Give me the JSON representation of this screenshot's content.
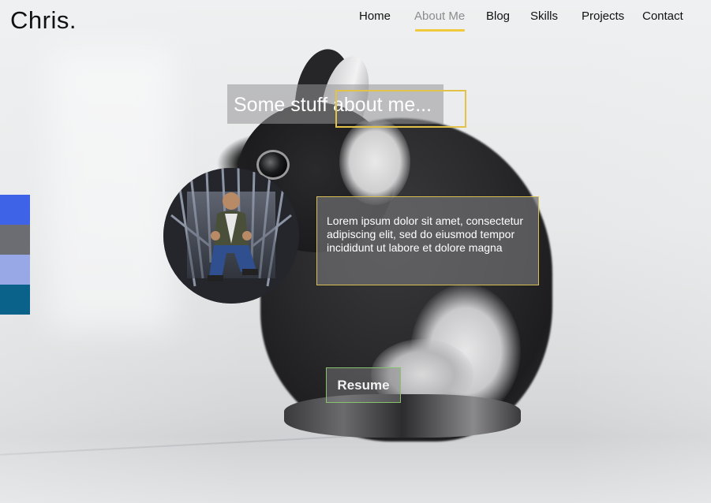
{
  "logo": "Chris.",
  "nav": {
    "items": [
      {
        "label": "Home",
        "active": false
      },
      {
        "label": "About Me",
        "active": true
      },
      {
        "label": "Blog",
        "active": false
      },
      {
        "label": "Skills",
        "active": false
      },
      {
        "label": "Projects",
        "active": false
      },
      {
        "label": "Contact",
        "active": false
      }
    ],
    "active_underline_color": "#f0c93d"
  },
  "swatches": [
    "#3f63e6",
    "#6b6d72",
    "#98a8e6",
    "#0a6189"
  ],
  "about": {
    "heading": "Some stuff about me...",
    "bio": "Lorem ipsum dolor sit amet, consectetur adipiscing elit, sed do eiusmod tempor incididunt ut labore et dolore magna",
    "resume_label": "Resume",
    "avatar_icon": "profile-photo"
  },
  "colors": {
    "accent": "#e3c24a",
    "resume_border": "#86c36c"
  }
}
